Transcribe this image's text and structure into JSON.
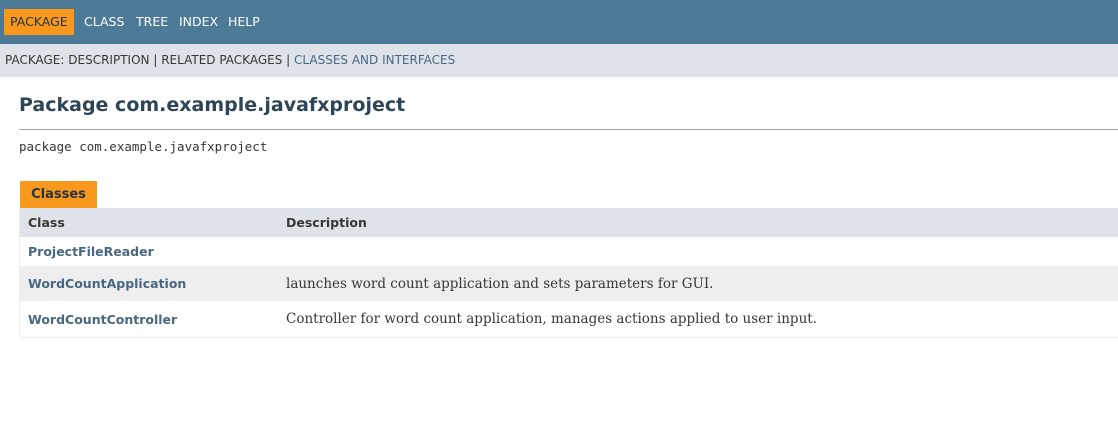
{
  "top_nav": {
    "items": [
      {
        "label": "PACKAGE",
        "active": true
      },
      {
        "label": "CLASS",
        "active": false
      },
      {
        "label": "TREE",
        "active": false
      },
      {
        "label": "INDEX",
        "active": false
      },
      {
        "label": "HELP",
        "active": false
      }
    ]
  },
  "sub_nav": {
    "prefix": "PACKAGE:",
    "description": "DESCRIPTION",
    "separator": "|",
    "related": "RELATED PACKAGES",
    "classes_and_interfaces": "CLASSES AND INTERFACES"
  },
  "header": {
    "title": "Package com.example.javafxproject",
    "declaration": "package com.example.javafxproject"
  },
  "classes_summary": {
    "caption": "Classes",
    "columns": [
      "Class",
      "Description"
    ],
    "rows": [
      {
        "name": "ProjectFileReader",
        "description": ""
      },
      {
        "name": "WordCountApplication",
        "description": "launches word count application and sets parameters for GUI."
      },
      {
        "name": "WordCountController",
        "description": "Controller for word count application, manages actions applied to user input."
      }
    ]
  },
  "colors": {
    "nav_bar": "#4d7a97",
    "sub_nav": "#dee3e9",
    "accent": "#f8981d",
    "link": "#4a6782",
    "row_alt": "#eeeeef"
  }
}
